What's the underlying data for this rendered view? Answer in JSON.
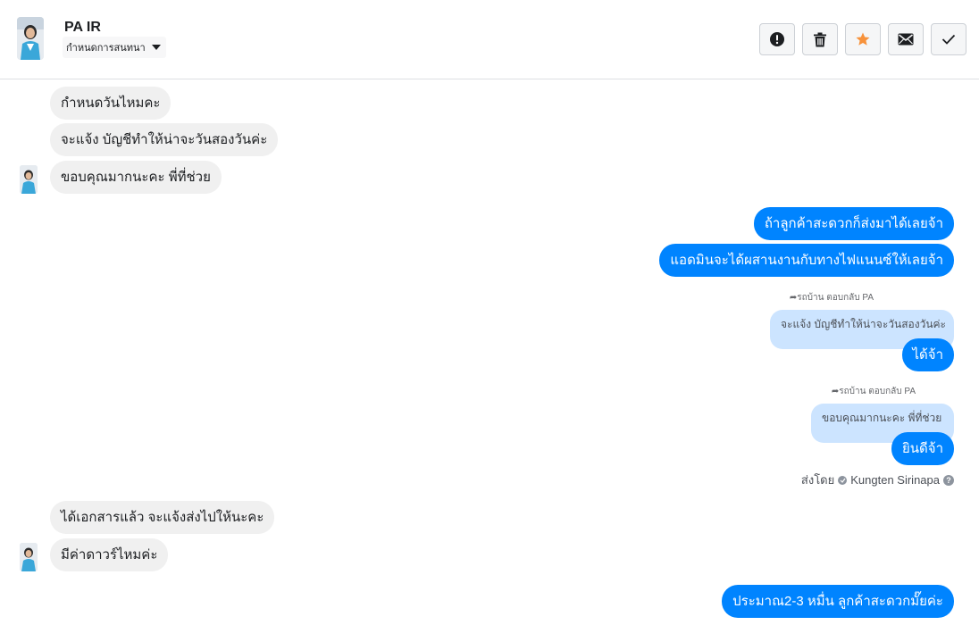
{
  "header": {
    "name": "PA IR",
    "topic_select": "กำหนดการสนทนา"
  },
  "toolbar": {
    "buttons": [
      "alert-icon",
      "trash-icon",
      "star-icon",
      "mail-icon",
      "check-icon"
    ],
    "star_color": "#f7923b"
  },
  "messages": {
    "in_1": "กำหนดวันไหมคะ",
    "in_2": "จะแจ้ง บัญชีทำให้น่าจะวันสองวันค่ะ",
    "in_3": "ขอบคุณมากนะคะ พี่ที่ช่วย",
    "out_1": "ถ้าลูกค้าสะดวกก็ส่งมาได้เลยจ้า",
    "out_2": "แอดมินจะได้ผสานงานกับทางไฟแนนซ์ให้เลยจ้า",
    "reply_label_1": "รถบ้าน ตอบกลับ PA",
    "quote_1": "จะแจ้ง บัญชีทำให้น่าจะวันสองวันค่ะ",
    "out_3": "ได้จ้า",
    "reply_label_2": "รถบ้าน ตอบกลับ PA",
    "quote_2": "ขอบคุณมากนะคะ พี่ที่ช่วย",
    "out_4": "ยินดีจ้า",
    "sent_by_prefix": "ส่งโดย",
    "sent_by_name": "Kungten Sirinapa",
    "in_4": "ได้เอกสารแล้ว จะแจ้งส่งไปให้นะคะ",
    "in_5": "มีค่าดาวร์ไหมค่ะ",
    "out_5": "ประมาณ2-3 หมื่น ลูกค้าสะดวกมั๊ยค่ะ"
  },
  "colors": {
    "outgoing": "#0084ff",
    "incoming": "#f0f0f0",
    "quote": "#cce4ff"
  }
}
